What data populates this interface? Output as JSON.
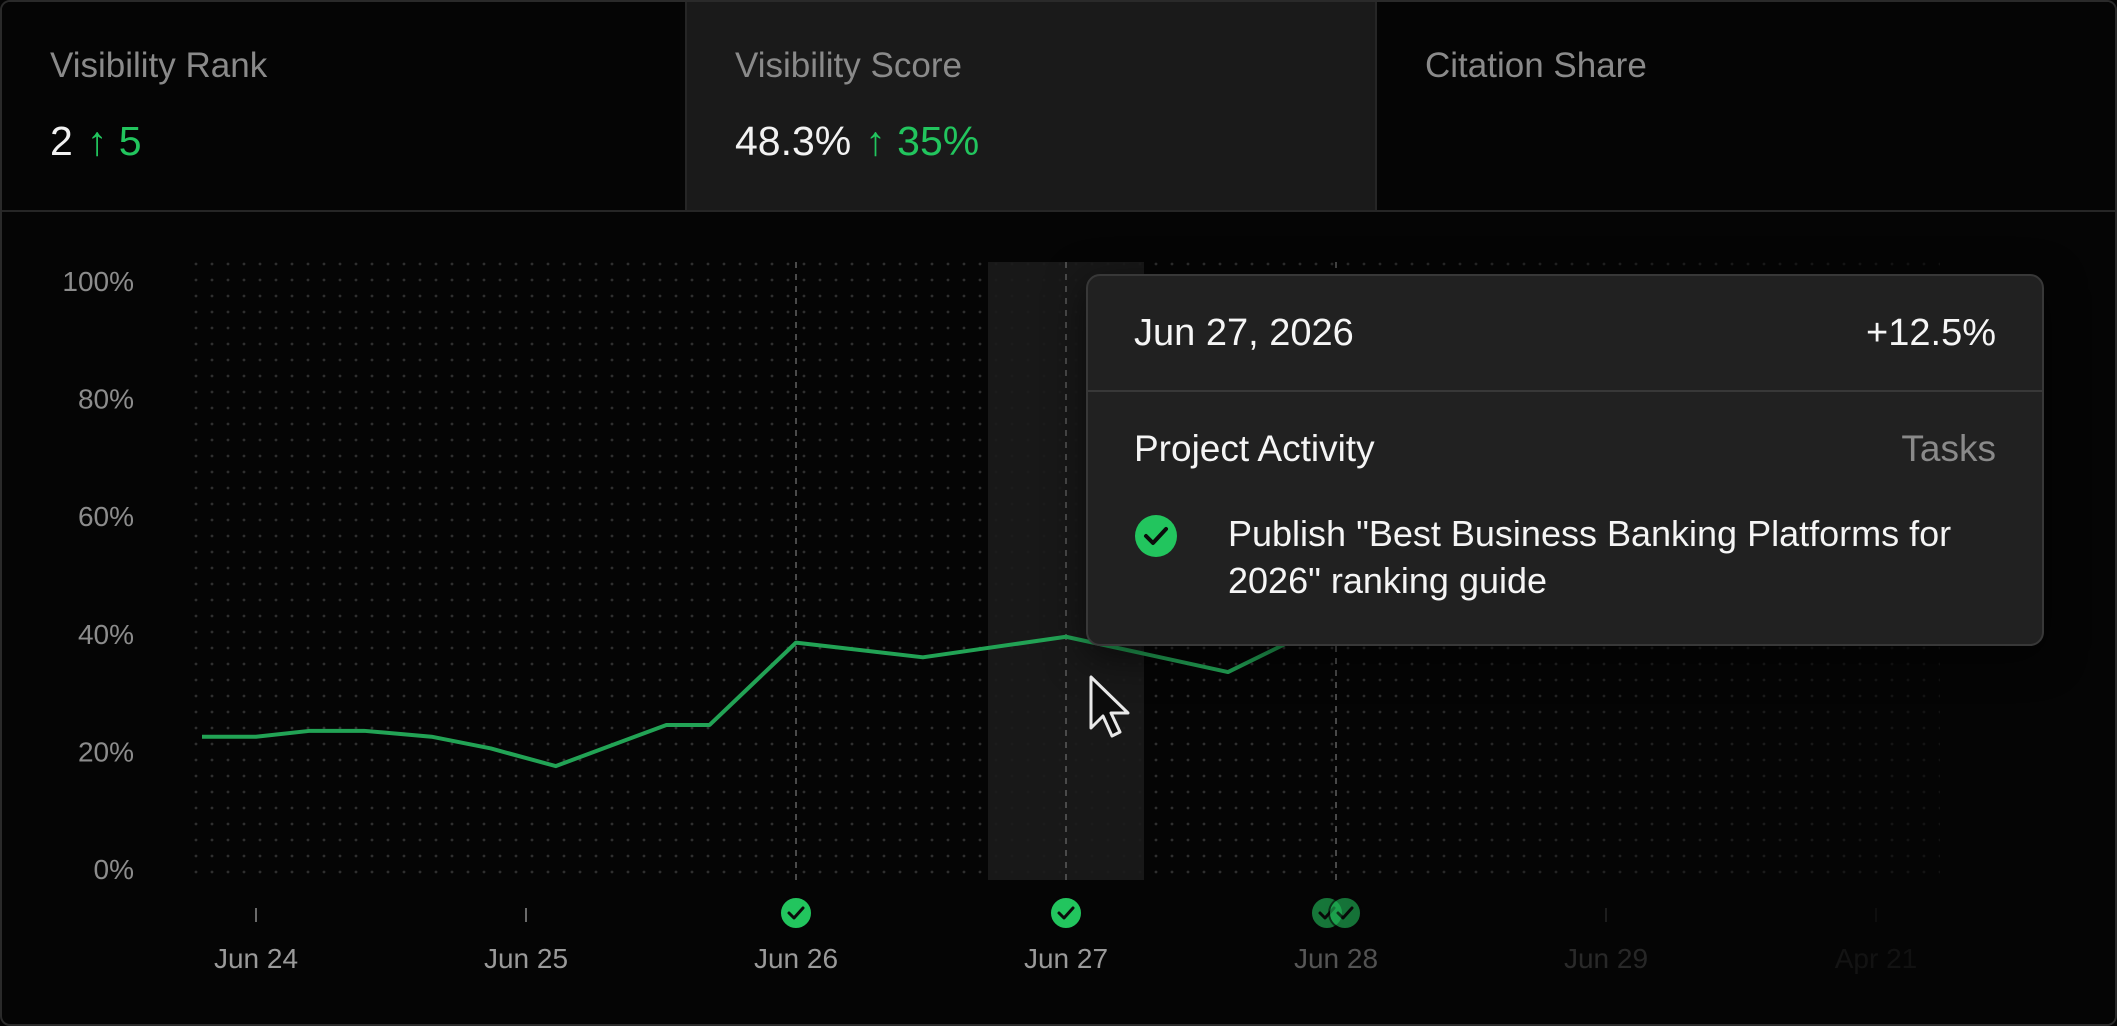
{
  "metrics": [
    {
      "label": "Visibility Rank",
      "value": "2",
      "delta": "↑ 5"
    },
    {
      "label": "Visibility Score",
      "value": "48.3%",
      "delta": "↑ 35%"
    },
    {
      "label": "Citation Share",
      "value": "",
      "delta": ""
    }
  ],
  "colors": {
    "accent": "#22c55e",
    "background": "#050505",
    "tooltip_bg": "#212121",
    "muted": "#8a8a8a"
  },
  "tooltip": {
    "date": "Jun 27, 2026",
    "change": "+12.5%",
    "section_title": "Project Activity",
    "section_right": "Tasks",
    "task_icon": "check-circle-icon",
    "task_text": "Publish \"Best Business Banking Platforms for 2026\" ranking guide"
  },
  "chart_data": {
    "type": "line",
    "ylim": [
      0,
      100
    ],
    "yticks": [
      "100%",
      "80%",
      "60%",
      "40%",
      "20%",
      "0%"
    ],
    "xticks": [
      "Jun 24",
      "Jun 25",
      "Jun 26",
      "Jun 27",
      "Jun 28",
      "Jun 29",
      "Apr 21"
    ],
    "grid": true,
    "highlighted_tick": "Jun 27",
    "series": [
      {
        "values": [
          {
            "x": 23.8,
            "y": 22.5
          },
          {
            "x": 24.0,
            "y": 22.5
          },
          {
            "x": 24.2,
            "y": 23.5
          },
          {
            "x": 24.4,
            "y": 23.5
          },
          {
            "x": 24.65,
            "y": 22.5
          },
          {
            "x": 24.87,
            "y": 20.5
          },
          {
            "x": 25.11,
            "y": 17.5
          },
          {
            "x": 25.52,
            "y": 24.5
          },
          {
            "x": 25.68,
            "y": 24.5
          },
          {
            "x": 26.0,
            "y": 38.5
          },
          {
            "x": 26.47,
            "y": 36.0
          },
          {
            "x": 27.0,
            "y": 39.5
          },
          {
            "x": 27.6,
            "y": 33.5
          },
          {
            "x": 28.0,
            "y": 42.5
          },
          {
            "x": 28.46,
            "y": 61.5
          },
          {
            "x": 29.0,
            "y": 41.5
          },
          {
            "x": 29.25,
            "y": 52.5
          },
          {
            "x": 29.49,
            "y": 55.5
          },
          {
            "x": 29.74,
            "y": 71.5
          },
          {
            "x": 30.13,
            "y": 53.5
          }
        ]
      }
    ],
    "task_markers": [
      {
        "x": "Jun 26",
        "count": 1
      },
      {
        "x": "Jun 27",
        "count": 1
      },
      {
        "x": "Jun 28",
        "count": 2
      }
    ]
  }
}
